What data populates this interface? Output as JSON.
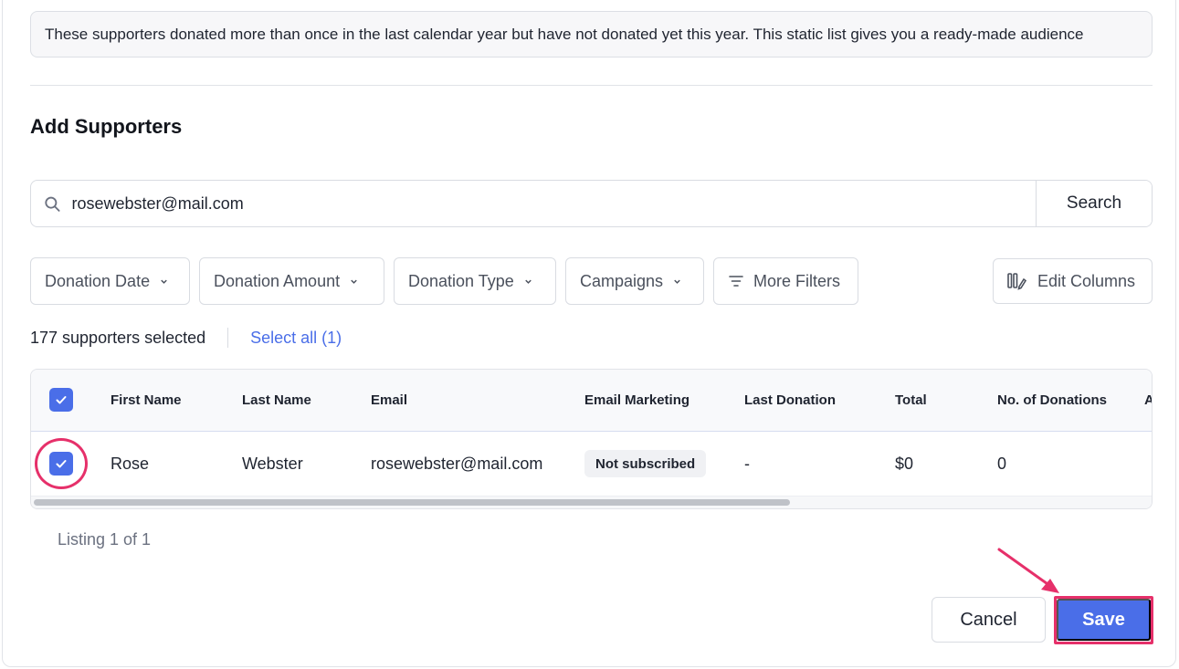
{
  "description": {
    "text": "These supporters donated more than once in the last calendar year but have not donated yet this year. This static list gives you a ready-made audience"
  },
  "section": {
    "title": "Add Supporters"
  },
  "search": {
    "value": "rosewebster@mail.com",
    "button_label": "Search",
    "icon": "search-icon"
  },
  "filters": {
    "items": [
      {
        "label": "Donation Date"
      },
      {
        "label": "Donation Amount"
      },
      {
        "label": "Donation Type"
      },
      {
        "label": "Campaigns"
      }
    ],
    "more_filters_label": "More Filters",
    "edit_columns_label": "Edit Columns"
  },
  "selection": {
    "count_text": "177 supporters selected",
    "select_all_label": "Select all (1)"
  },
  "table": {
    "columns": [
      "First Name",
      "Last Name",
      "Email",
      "Email Marketing",
      "Last Donation",
      "Total",
      "No. of Donations",
      "A"
    ],
    "rows": [
      {
        "first_name": "Rose",
        "last_name": "Webster",
        "email": "rosewebster@mail.com",
        "email_marketing": "Not subscribed",
        "last_donation": "-",
        "total": "$0",
        "donations": "0",
        "selected": true
      }
    ]
  },
  "pagination": {
    "text": "Listing 1 of 1"
  },
  "footer": {
    "cancel_label": "Cancel",
    "save_label": "Save"
  },
  "colors": {
    "accent": "#4a6ee8",
    "annotation": "#e6306a"
  }
}
